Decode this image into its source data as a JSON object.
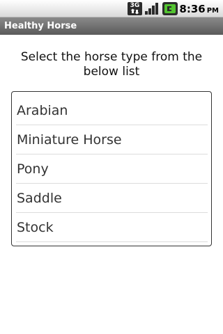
{
  "status_bar": {
    "network_label": "3G",
    "time": "8:36",
    "ampm": "PM",
    "icons": [
      "3g-icon",
      "signal-icon",
      "battery-charging-icon"
    ],
    "battery_color": "#53c431"
  },
  "app": {
    "title": "Healthy Horse"
  },
  "main": {
    "prompt": "Select the horse type from the below list",
    "items": [
      {
        "label": "Arabian"
      },
      {
        "label": "Miniature Horse"
      },
      {
        "label": "Pony"
      },
      {
        "label": "Saddle"
      },
      {
        "label": "Stock"
      }
    ]
  }
}
